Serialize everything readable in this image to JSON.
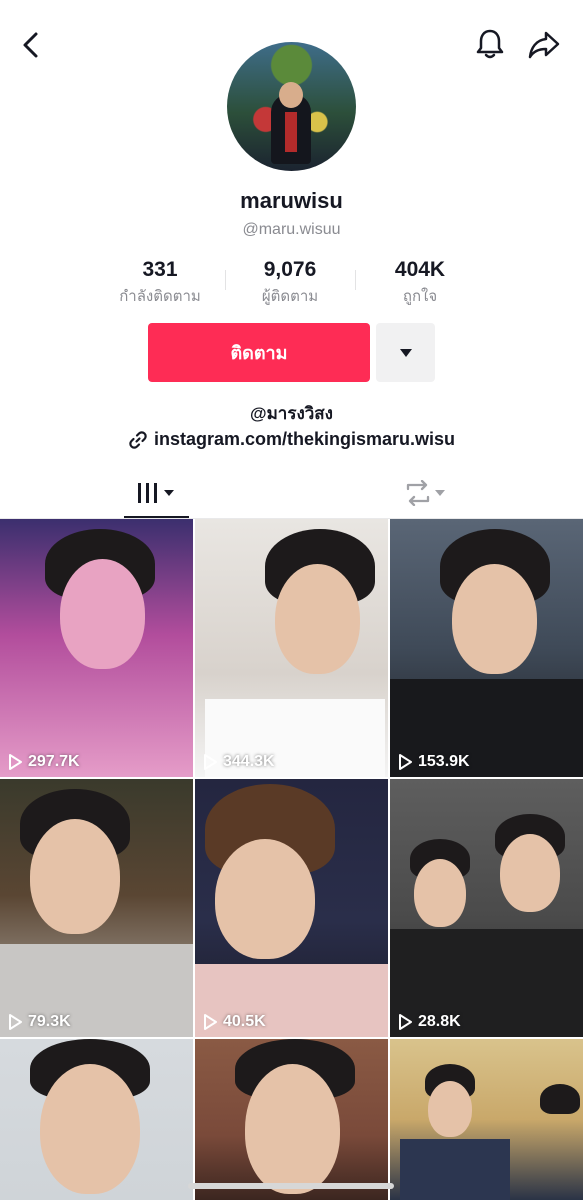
{
  "header": {
    "back_icon": "chevron-left-icon",
    "notification_icon": "bell-icon",
    "share_icon": "share-arrow-icon"
  },
  "profile": {
    "username": "maruwisu",
    "handle": "@maru.wisuu",
    "stats": [
      {
        "value": "331",
        "label": "กำลังติดตาม"
      },
      {
        "value": "9,076",
        "label": "ผู้ติดตาม"
      },
      {
        "value": "404K",
        "label": "ถูกใจ"
      }
    ],
    "follow_label": "ติดตาม",
    "more_icon": "caret-down-icon",
    "bio": "@มารงวิสง",
    "link": "instagram.com/thekingismaru.wisu",
    "link_icon": "link-icon"
  },
  "tabs": {
    "videos_icon": "grid-bars-icon",
    "reposts_icon": "repost-icon"
  },
  "videos": [
    {
      "views": "297.7K",
      "bg": "#c86fb0"
    },
    {
      "views": "344.3K",
      "bg": "#e9e6e2"
    },
    {
      "views": "153.9K",
      "bg": "#3f4a58"
    },
    {
      "views": "79.3K",
      "bg": "#5a4633"
    },
    {
      "views": "40.5K",
      "bg": "#2a2e4a"
    },
    {
      "views": "28.8K",
      "bg": "#4a4a4a"
    },
    {
      "views": "",
      "bg": "#cfd4d8"
    },
    {
      "views": "",
      "bg": "#7a4a3a"
    },
    {
      "views": "",
      "bg": "#c9a86a"
    }
  ],
  "colors": {
    "primary": "#fe2c55",
    "text": "#161823",
    "muted": "#8a8b91"
  }
}
